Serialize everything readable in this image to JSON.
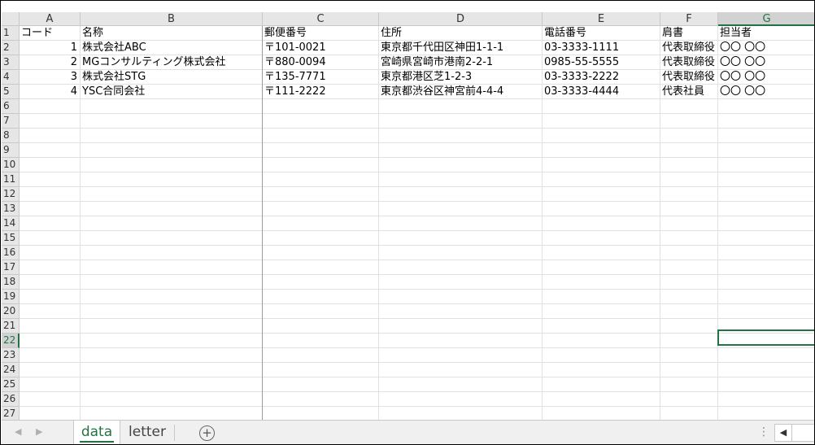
{
  "columns": [
    {
      "letter": "A",
      "selected": false
    },
    {
      "letter": "B",
      "selected": false
    },
    {
      "letter": "C",
      "selected": false
    },
    {
      "letter": "D",
      "selected": false
    },
    {
      "letter": "E",
      "selected": false
    },
    {
      "letter": "F",
      "selected": false
    },
    {
      "letter": "G",
      "selected": true
    }
  ],
  "rows": [
    "1",
    "2",
    "3",
    "4",
    "5",
    "6",
    "7",
    "8",
    "9",
    "10",
    "11",
    "12",
    "13",
    "14",
    "15",
    "16",
    "17",
    "18",
    "19",
    "20",
    "21",
    "22",
    "23",
    "24",
    "25",
    "26",
    "27"
  ],
  "selected_row": "22",
  "header": {
    "code": "コード",
    "name": "名称",
    "postal": "郵便番号",
    "address": "住所",
    "phone": "電話番号",
    "title": "肩書",
    "contact": "担当者"
  },
  "records": [
    {
      "code": "1",
      "name": "株式会社ABC",
      "postal": "〒101-0021",
      "address": "東京都千代田区神田1-1-1",
      "phone": "03-3333-1111",
      "title": "代表取締役",
      "contact": "〇〇 〇〇"
    },
    {
      "code": "2",
      "name": "MGコンサルティング株式会社",
      "postal": "〒880-0094",
      "address": "宮崎県宮崎市港南2-2-1",
      "phone": "0985-55-5555",
      "title": "代表取締役",
      "contact": "〇〇 〇〇"
    },
    {
      "code": "3",
      "name": "株式会社STG",
      "postal": "〒135-7771",
      "address": "東京都港区芝1-2-3",
      "phone": "03-3333-2222",
      "title": "代表取締役",
      "contact": "〇〇 〇〇"
    },
    {
      "code": "4",
      "name": "YSC合同会社",
      "postal": "〒111-2222",
      "address": "東京都渋谷区神宮前4-4-4",
      "phone": "03-3333-4444",
      "title": "代表社員",
      "contact": "〇〇 〇〇"
    }
  ],
  "sheets": {
    "data": "data",
    "letter": "letter",
    "active": "data"
  },
  "tabbar": {
    "prev_icon": "◀",
    "next_icon": "▶",
    "add_icon": "+",
    "dots": "⋮",
    "scroll_left": "◀"
  },
  "colors": {
    "accent": "#217346",
    "header_bg": "#e6e6e6",
    "gridline": "#e1e1e1"
  }
}
